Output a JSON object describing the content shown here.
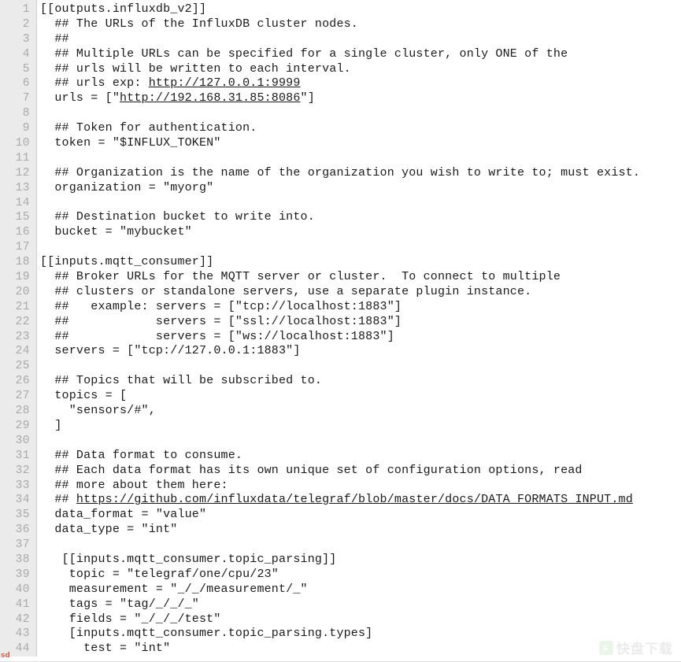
{
  "editor": {
    "language": "toml",
    "gutter_background": "#ebebeb",
    "gutter_text_color": "#a9a9a9",
    "text_color": "#1a1a1a",
    "background": "#ffffff",
    "first_visible_line": 1,
    "last_visible_line": 44,
    "total_visible_lines": 44
  },
  "line_numbers": [
    "1",
    "2",
    "3",
    "4",
    "5",
    "6",
    "7",
    "8",
    "9",
    "10",
    "11",
    "12",
    "13",
    "14",
    "15",
    "16",
    "17",
    "18",
    "19",
    "20",
    "21",
    "22",
    "23",
    "24",
    "25",
    "26",
    "27",
    "28",
    "29",
    "30",
    "31",
    "32",
    "33",
    "34",
    "35",
    "36",
    "37",
    "38",
    "39",
    "40",
    "41",
    "42",
    "43",
    "44"
  ],
  "code_lines": [
    "[[outputs.influxdb_v2]]",
    "  ## The URLs of the InfluxDB cluster nodes.",
    "  ##",
    "  ## Multiple URLs can be specified for a single cluster, only ONE of the",
    "  ## urls will be written to each interval.",
    "  ## urls exp: http://127.0.0.1:9999",
    "  urls = [\"http://192.168.31.85:8086\"]",
    "",
    "  ## Token for authentication.",
    "  token = \"$INFLUX_TOKEN\"",
    "",
    "  ## Organization is the name of the organization you wish to write to; must exist.",
    "  organization = \"myorg\"",
    "",
    "  ## Destination bucket to write into.",
    "  bucket = \"mybucket\"",
    "",
    "[[inputs.mqtt_consumer]]",
    "  ## Broker URLs for the MQTT server or cluster.  To connect to multiple",
    "  ## clusters or standalone servers, use a separate plugin instance.",
    "  ##   example: servers = [\"tcp://localhost:1883\"]",
    "  ##            servers = [\"ssl://localhost:1883\"]",
    "  ##            servers = [\"ws://localhost:1883\"]",
    "  servers = [\"tcp://127.0.0.1:1883\"]",
    "",
    "  ## Topics that will be subscribed to.",
    "  topics = [",
    "    \"sensors/#\",",
    "  ]",
    "",
    "  ## Data format to consume.",
    "  ## Each data format has its own unique set of configuration options, read",
    "  ## more about them here:",
    "  ## https://github.com/influxdata/telegraf/blob/master/docs/DATA_FORMATS_INPUT.md",
    "  data_format = \"value\"",
    "  data_type = \"int\"",
    "",
    "   [[inputs.mqtt_consumer.topic_parsing]]",
    "    topic = \"telegraf/one/cpu/23\"",
    "    measurement = \"_/_/measurement/_\"",
    "    tags = \"tag/_/_/_\"",
    "    fields = \"_/_/_/test\"",
    "    [inputs.mqtt_consumer.topic_parsing.types]",
    "      test = \"int\""
  ],
  "underlined_links": [
    {
      "line_index": 5,
      "text": "http://127.0.0.1:9999"
    },
    {
      "line_index": 6,
      "text": "http://192.168.31.85:8086"
    },
    {
      "line_index": 33,
      "text": "https://github.com/influxdata/telegraf/blob/master/docs/DATA_FORMATS_INPUT.md"
    }
  ],
  "watermark": {
    "text": "快盘下载",
    "logo_color": "#3fae2a"
  },
  "corner_mark": {
    "text": "sd",
    "color": "#c23b22"
  }
}
